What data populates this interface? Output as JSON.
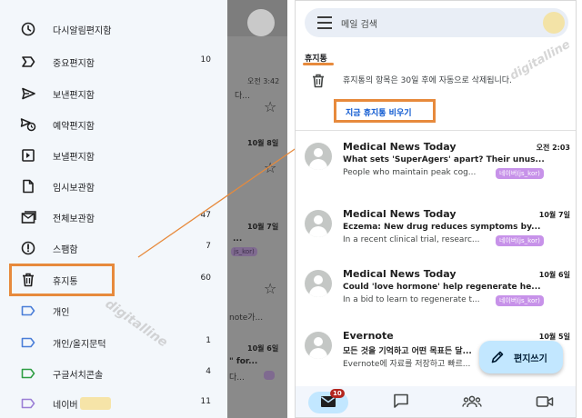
{
  "drawer": {
    "items": [
      {
        "label": "다시알림편지함",
        "count": "",
        "icon": "clock-icon"
      },
      {
        "label": "중요편지함",
        "count": "10",
        "icon": "important-icon"
      },
      {
        "label": "보낸편지함",
        "count": "",
        "icon": "send-icon"
      },
      {
        "label": "예약편지함",
        "count": "",
        "icon": "scheduled-send-icon"
      },
      {
        "label": "보낼편지함",
        "count": "",
        "icon": "outbox-icon"
      },
      {
        "label": "임시보관함",
        "count": "",
        "icon": "draft-icon"
      },
      {
        "label": "전체보관함",
        "count": "47",
        "icon": "all-mail-icon"
      },
      {
        "label": "스팸함",
        "count": "7",
        "icon": "spam-icon"
      },
      {
        "label": "휴지통",
        "count": "60",
        "icon": "trash-icon"
      },
      {
        "label": "개인",
        "count": "",
        "icon": "label-icon"
      },
      {
        "label": "개인/올지문턱",
        "count": "1",
        "icon": "label-icon"
      },
      {
        "label": "구글서치콘솔",
        "count": "4",
        "icon": "label-icon"
      },
      {
        "label": "네이버",
        "count": "11",
        "icon": "label-icon"
      }
    ]
  },
  "background_fragments": {
    "time1": "오전 3:42",
    "text1": "다...",
    "date1": "10월 8일",
    "date2": "10월 7일",
    "text2": "...",
    "badge": "js_kor)",
    "text3": "note가...",
    "date3": "10월 6일",
    "text4": "\" for...",
    "text5": "다..."
  },
  "watermark": "digitalline",
  "search": {
    "placeholder": "메일 검색"
  },
  "folder": {
    "title": "휴지통",
    "notice": "휴지통의 항목은 30일 후에 자동으로 삭제됩니다.",
    "empty_button": "지금 휴지통 비우기"
  },
  "emails": [
    {
      "sender": "Medical News Today",
      "date": "오전 2:03",
      "subject": "What sets 'SuperAgers' apart? Their unus...",
      "preview": "People who maintain peak cog...",
      "label": "네이버(js_kor)"
    },
    {
      "sender": "Medical News Today",
      "date": "10월 7일",
      "subject": "Eczema: New drug reduces symptoms by...",
      "preview": "In a recent clinical trial, researc...",
      "label": "네이버(js_kor)"
    },
    {
      "sender": "Medical News Today",
      "date": "10월 6일",
      "subject": "Could 'love hormone' help regenerate he...",
      "preview": "In a bid to learn to regenerate t...",
      "label": "네이버(js_kor)"
    },
    {
      "sender": "Evernote",
      "date": "10월 5일",
      "subject": "모든 것을 기억하고 어떤 목표든 달...",
      "preview": "Evernote에 자료를 저장하고 빠르...",
      "label": ""
    }
  ],
  "compose": {
    "label": "편지쓰기"
  },
  "bottom_nav": {
    "mail_badge": "10"
  },
  "colors": {
    "highlight": "#e78a3c",
    "drawer_bg": "#f3f7fb",
    "link_blue": "#0b57d0",
    "label_chip": "#c792e9",
    "fab_bg": "#c2e7ff"
  }
}
